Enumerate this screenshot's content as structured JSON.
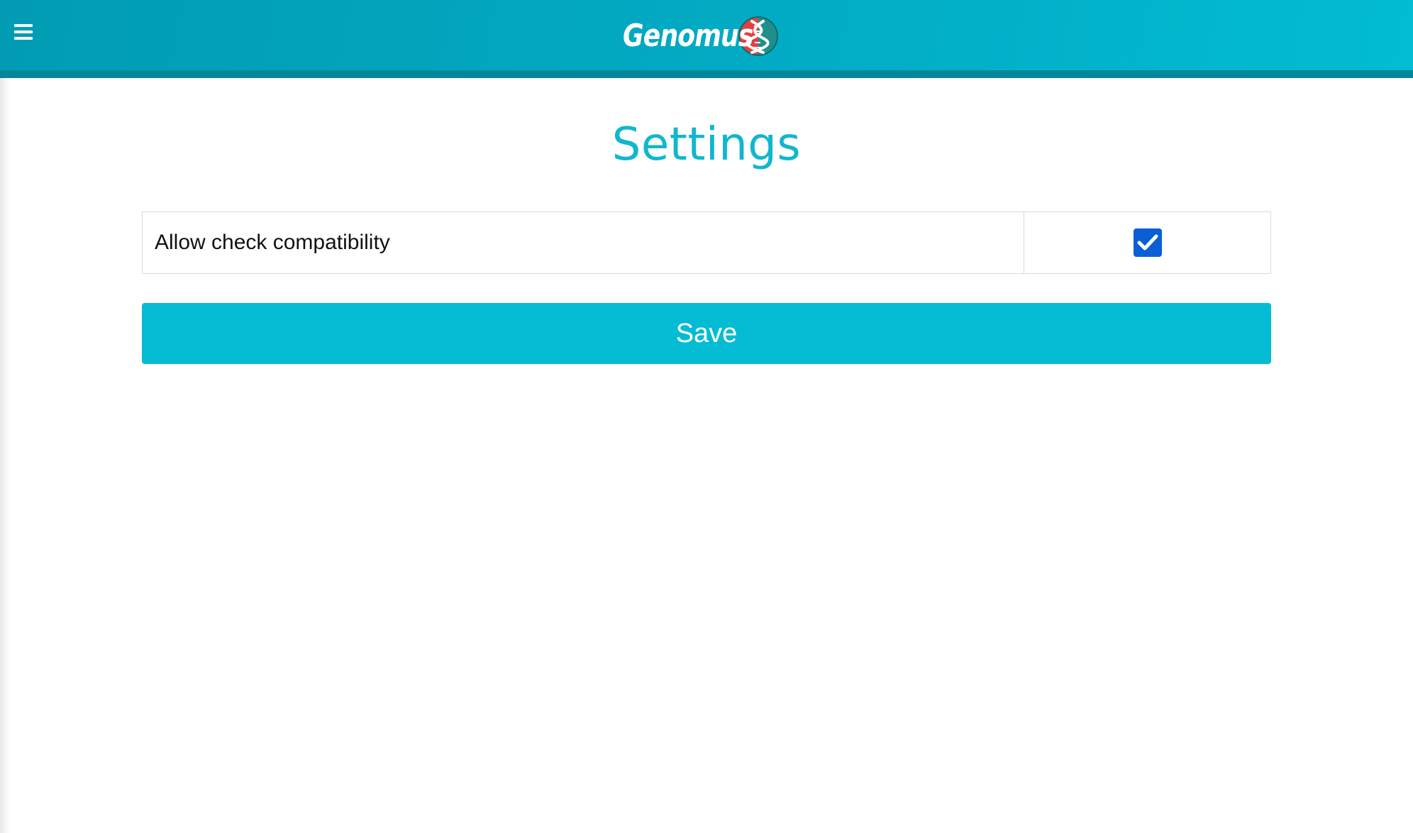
{
  "header": {
    "logo_text": "Genomus",
    "menu_icon": "hamburger-menu-icon",
    "logo_icon": "dna-helix-icon",
    "colors": {
      "header_start": "#019cb3",
      "header_end": "#01bcd2",
      "header_strip": "#03879a"
    }
  },
  "page": {
    "title": "Settings",
    "title_color": "#11b6cf"
  },
  "settings": [
    {
      "label": "Allow check compatibility",
      "checked": true
    }
  ],
  "actions": {
    "save_label": "Save",
    "save_color": "#03bcd4"
  },
  "checkbox_color": "#0a5fd4"
}
